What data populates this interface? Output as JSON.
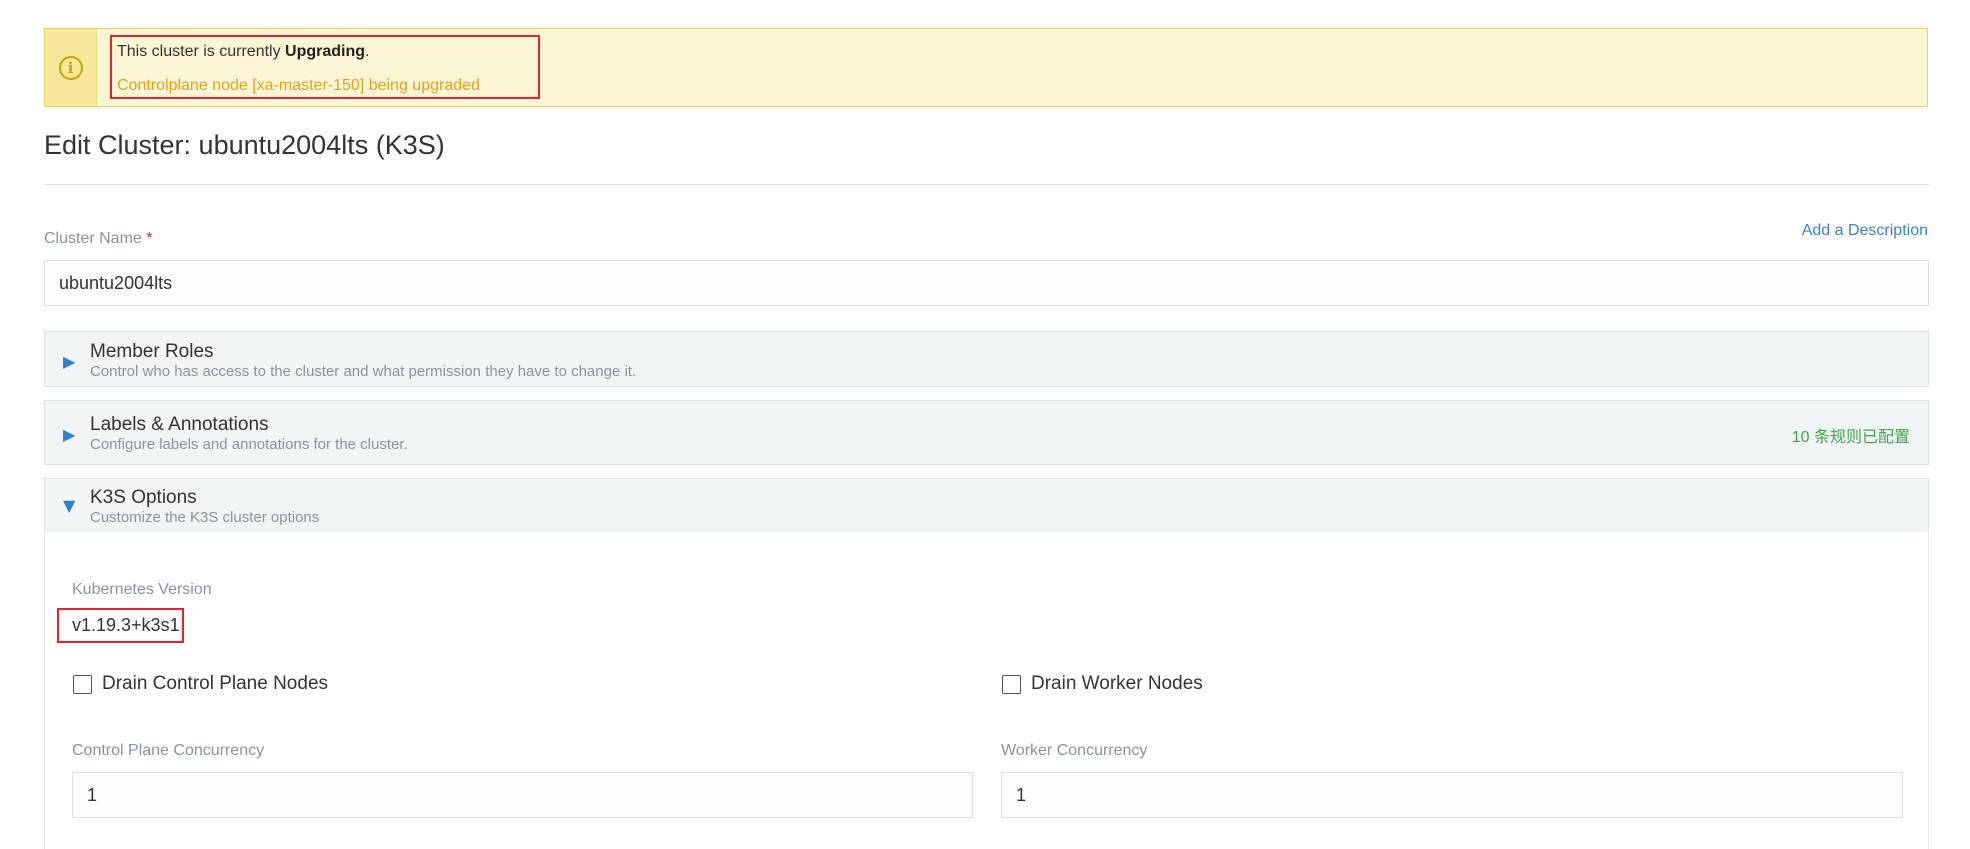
{
  "alert": {
    "prefix": "This cluster is currently ",
    "state": "Upgrading",
    "suffix": ".",
    "detail": "Controlplane node [xa-master-150] being upgraded",
    "icon": "info-icon"
  },
  "page": {
    "title": "Edit Cluster: ubuntu2004lts (K3S)"
  },
  "cluster_name": {
    "label": "Cluster Name",
    "required_mark": "*",
    "value": "ubuntu2004lts",
    "add_description": "Add a Description"
  },
  "sections": {
    "member_roles": {
      "title": "Member Roles",
      "subtitle": "Control who has access to the cluster and what permission they have to change it.",
      "arrow": "▶"
    },
    "labels": {
      "title": "Labels & Annotations",
      "subtitle": "Configure labels and annotations for the cluster.",
      "badge": "10 条规则已配置",
      "arrow": "▶"
    },
    "k3s": {
      "title": "K3S Options",
      "subtitle": "Customize the K3S cluster options",
      "arrow": "▼"
    }
  },
  "k3s_options": {
    "version_label": "Kubernetes Version",
    "version_value": "v1.19.3+k3s1",
    "drain_control_plane_label": "Drain Control Plane Nodes",
    "drain_worker_label": "Drain Worker Nodes",
    "cp_concurrency_label": "Control Plane Concurrency",
    "cp_concurrency_value": "1",
    "worker_concurrency_label": "Worker Concurrency",
    "worker_concurrency_value": "1"
  },
  "colors": {
    "alert_bg": "#fdf6d6",
    "alert_border": "#e9d45a",
    "alert_detail": "#e6a11b",
    "highlight": "#e8212a",
    "link": "#3b82c4",
    "badge": "#3da84a",
    "arrow": "#2f7fd1"
  }
}
